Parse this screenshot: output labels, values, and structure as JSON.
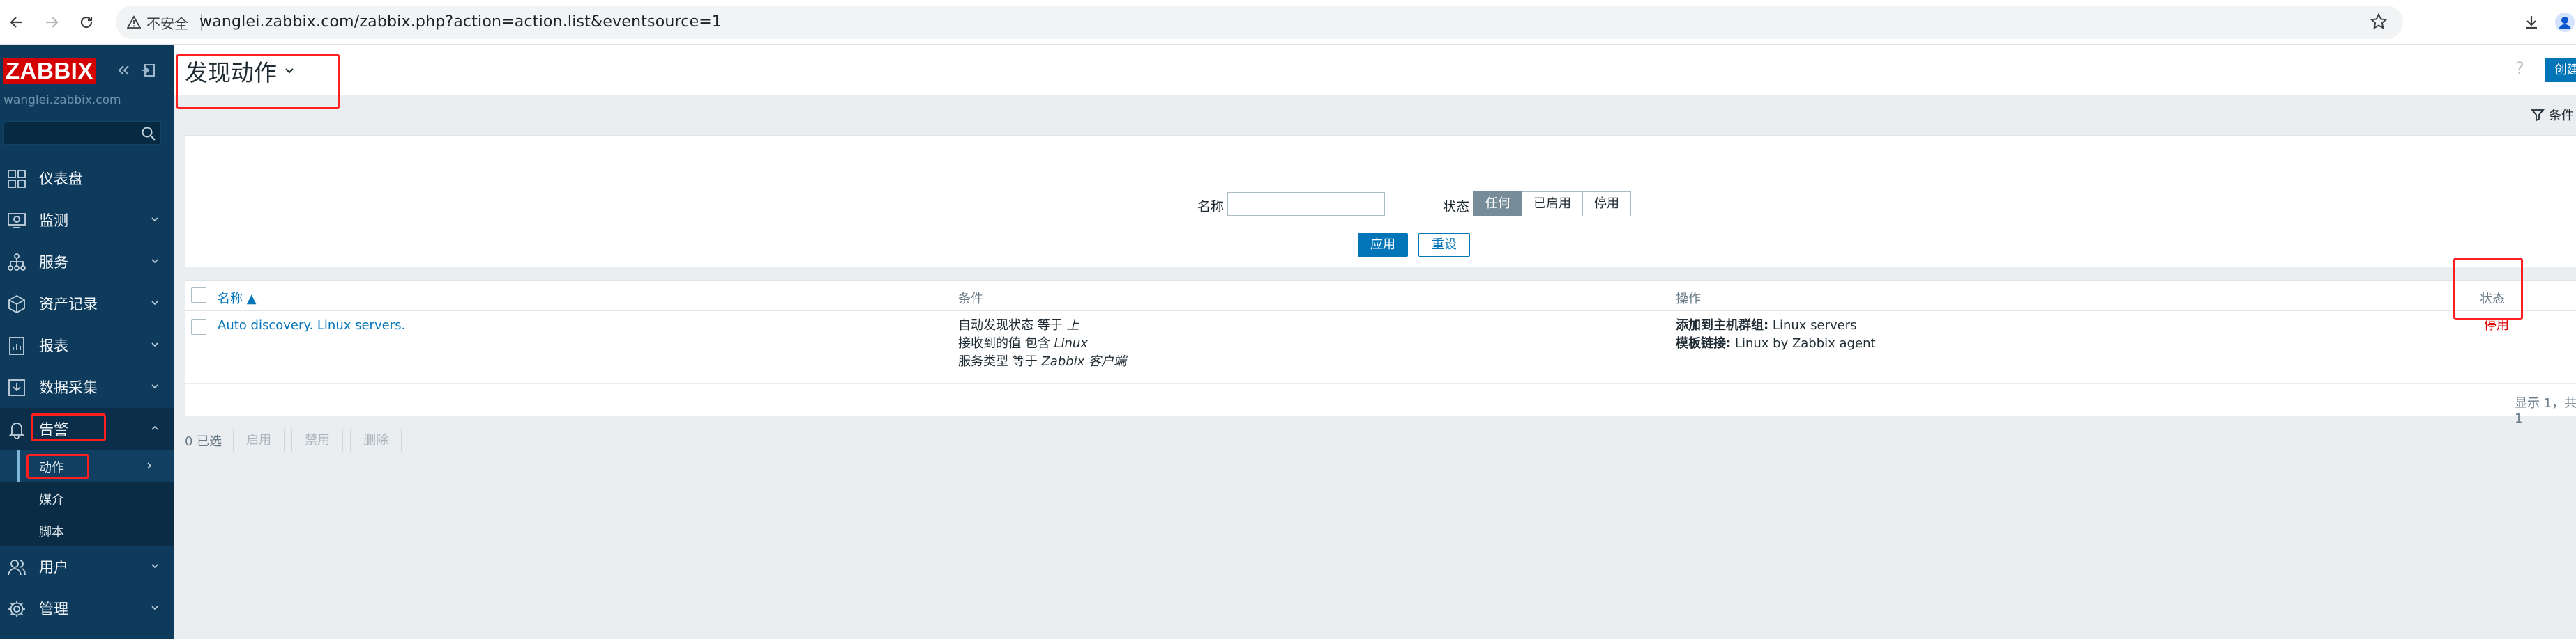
{
  "browser": {
    "security_label": "不安全",
    "url": "wanglei.zabbix.com/zabbix.php?action=action.list&eventsource=1"
  },
  "sidebar": {
    "logo": "ZABBIX",
    "server": "wanglei.zabbix.com",
    "menu": [
      {
        "label": "仪表盘",
        "icon": "dashboard-icon"
      },
      {
        "label": "监测",
        "icon": "monitoring-icon"
      },
      {
        "label": "服务",
        "icon": "services-icon"
      },
      {
        "label": "资产记录",
        "icon": "inventory-icon"
      },
      {
        "label": "报表",
        "icon": "reports-icon"
      },
      {
        "label": "数据采集",
        "icon": "data-collection-icon"
      },
      {
        "label": "告警",
        "icon": "alerts-icon"
      },
      {
        "label": "用户",
        "icon": "users-icon"
      },
      {
        "label": "管理",
        "icon": "administration-icon"
      }
    ],
    "alerts_submenu": [
      {
        "label": "动作"
      },
      {
        "label": "媒介"
      },
      {
        "label": "脚本"
      }
    ]
  },
  "header": {
    "title": "发现动作",
    "help": "?",
    "create_label": "创建"
  },
  "filter": {
    "tab_label": "条件",
    "name_label": "名称",
    "name_value": "",
    "status_label": "状态",
    "status_options": [
      "任何",
      "已启用",
      "停用"
    ],
    "apply_label": "应用",
    "reset_label": "重设"
  },
  "table": {
    "headers": {
      "name": "名称 ▲",
      "conditions": "条件",
      "operations": "操作",
      "status": "状态"
    },
    "rows": [
      {
        "name": "Auto discovery. Linux servers.",
        "conditions": [
          {
            "text": "自动发现状态 等于 ",
            "value": "上"
          },
          {
            "text": "接收到的值 包含 ",
            "value": "Linux"
          },
          {
            "text": "服务类型 等于 ",
            "value": "Zabbix 客户端"
          }
        ],
        "operations": [
          {
            "label": "添加到主机群组:",
            "value": " Linux servers"
          },
          {
            "label": "模板链接:",
            "value": " Linux by Zabbix agent"
          }
        ],
        "status": "停用"
      }
    ],
    "footer": "显示 1，共 1"
  },
  "mass_actions": {
    "selected": "0 已选",
    "enable": "启用",
    "disable": "禁用",
    "delete": "删除"
  },
  "colors": {
    "sidebar": "#0e3b5c",
    "accent": "#0275b8",
    "logo": "#d40000",
    "status_disabled": "#dc0000",
    "annotation": "#ff1f1f"
  }
}
